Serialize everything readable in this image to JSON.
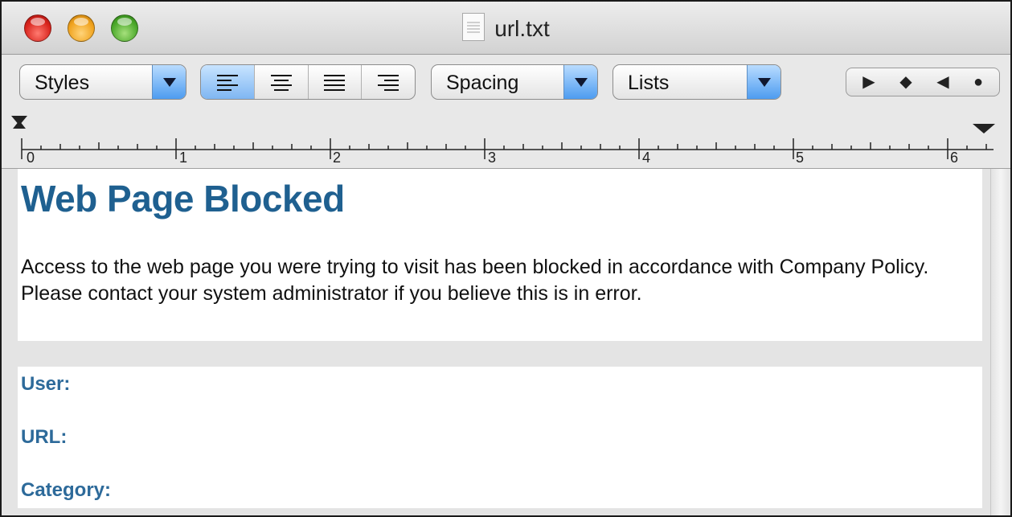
{
  "window": {
    "title": "url.txt"
  },
  "toolbar": {
    "styles_label": "Styles",
    "spacing_label": "Spacing",
    "lists_label": "Lists",
    "alignment": [
      "align-left",
      "align-center",
      "justify",
      "align-right"
    ],
    "selected_alignment": "align-left",
    "nav_icons": [
      "play-right-icon",
      "diamond-icon",
      "play-left-icon",
      "circle-icon"
    ]
  },
  "ruler": {
    "marks": [
      "0",
      "1",
      "2",
      "3",
      "4",
      "5",
      "6"
    ]
  },
  "document": {
    "heading": "Web Page Blocked",
    "message": "Access to the web page you were trying to visit has been blocked in accordance with Company Policy. Please contact your system administrator if you believe this is in error.",
    "fields": {
      "user_label": "User:",
      "url_label": "URL:",
      "category_label": "Category:"
    }
  },
  "colors": {
    "heading": "#1f6090",
    "field_label": "#2d6a9a",
    "dropdown_arrow": "#4d9cf0"
  }
}
